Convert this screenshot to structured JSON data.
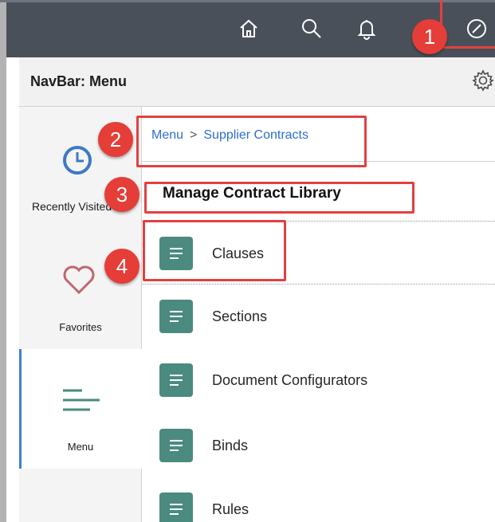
{
  "navbar": {
    "title": "NavBar: Menu",
    "icons": [
      "home-icon",
      "search-icon",
      "bell-icon",
      "compass-icon"
    ],
    "settings_icon": "gear-icon"
  },
  "sidebar": {
    "items": [
      {
        "label": "Recently Visited",
        "icon": "clock-icon",
        "active": false
      },
      {
        "label": "Favorites",
        "icon": "heart-icon",
        "active": false
      },
      {
        "label": "Menu",
        "icon": "menu-lines-icon",
        "active": true
      }
    ]
  },
  "breadcrumb": {
    "root": "Menu",
    "separator": ">",
    "current": "Supplier Contracts"
  },
  "section": {
    "title": "Manage Contract Library"
  },
  "items": [
    {
      "label": "Clauses",
      "icon": "list-icon"
    },
    {
      "label": "Sections",
      "icon": "list-icon"
    },
    {
      "label": "Document Configurators",
      "icon": "list-icon"
    },
    {
      "label": "Binds",
      "icon": "list-icon"
    },
    {
      "label": "Rules",
      "icon": "list-icon"
    }
  ],
  "callouts": [
    "1",
    "2",
    "3",
    "4"
  ],
  "colors": {
    "topbar": "#4a5059",
    "tile": "#4a8a7f",
    "link": "#2d6ed0",
    "callout": "#e53d38",
    "active_indicator": "#3f7fd6"
  }
}
